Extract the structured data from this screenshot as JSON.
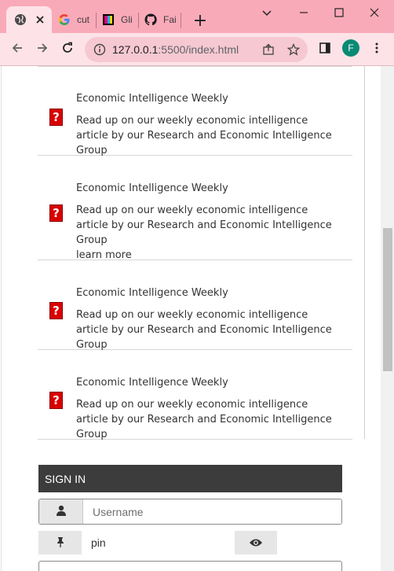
{
  "browser": {
    "tabs": [
      {
        "label": "",
        "icon": "globe-icon",
        "active": true
      },
      {
        "label": "cut",
        "icon": "google-icon",
        "active": false
      },
      {
        "label": "Gli",
        "icon": "glitch-icon",
        "active": false
      },
      {
        "label": "Fai",
        "icon": "github-icon",
        "active": false
      }
    ],
    "new_tab_label": "+",
    "url_host": "127.0.0.1",
    "url_rest": ":5500/index.html",
    "profile_initial": "F",
    "accent_color": "#f9aab9",
    "avatar_color": "#0a8a74"
  },
  "news": {
    "items": [
      {
        "title": "Economic Intelligence Weekly",
        "body": "Read up on our weekly economic intelligence article by our Research and Economic Intelligence Group",
        "link": ""
      },
      {
        "title": "Economic Intelligence Weekly",
        "body": "Read up on our weekly economic intelligence article by our Research and Economic Intelligence Group",
        "link": "learn more"
      },
      {
        "title": "Economic Intelligence Weekly",
        "body": "Read up on our weekly economic intelligence article by our Research and Economic Intelligence Group",
        "link": ""
      },
      {
        "title": "Economic Intelligence Weekly",
        "body": "Read up on our weekly economic intelligence article by our Research and Economic Intelligence Group",
        "link": ""
      }
    ],
    "icon": "broken-image-icon",
    "icon_glyph": "?"
  },
  "signin": {
    "header": "SIGN IN",
    "username_placeholder": "Username",
    "pin_value": "pin",
    "user_icon": "user-icon",
    "pin_icon": "pushpin-icon",
    "eye_icon": "eye-icon"
  }
}
